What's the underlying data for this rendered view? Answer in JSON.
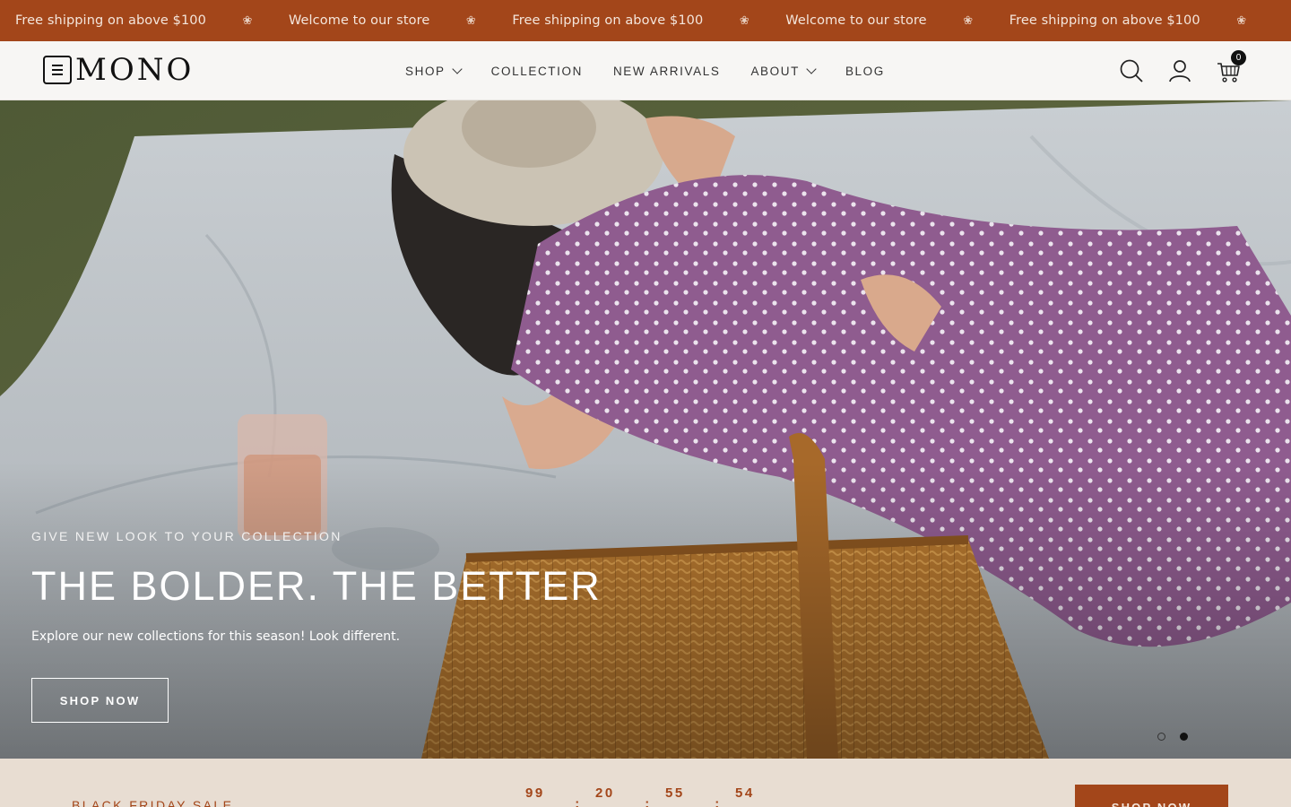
{
  "announcement": {
    "items": [
      "Free shipping on above $100",
      "Welcome to our store",
      "Free shipping on above $100",
      "Welcome to our store",
      "Free shipping on above $100"
    ],
    "separator": "❀"
  },
  "header": {
    "logo_text": "MONO",
    "nav": [
      {
        "label": "SHOP",
        "dropdown": true
      },
      {
        "label": "COLLECTION",
        "dropdown": false
      },
      {
        "label": "NEW ARRIVALS",
        "dropdown": false
      },
      {
        "label": "ABOUT",
        "dropdown": true
      },
      {
        "label": "BLOG",
        "dropdown": false
      }
    ],
    "icons": [
      "search-icon",
      "account-icon",
      "cart-icon"
    ],
    "cart_count": "0"
  },
  "hero": {
    "eyebrow": "GIVE NEW LOOK TO YOUR COLLECTION",
    "title": "THE BOLDER. THE BETTER",
    "subtitle": "Explore our new collections for this season! Look different.",
    "button_label": "SHOP NOW",
    "slides_total": 2,
    "active_slide": 2
  },
  "promo": {
    "label": "BLACK FRIDAY SALE",
    "countdown": [
      "99",
      "20",
      "55",
      "54"
    ],
    "separator": ":",
    "button_label": "SHOP NOW"
  },
  "colors": {
    "accent": "#a3461a",
    "promo_bg": "#e8ddd2",
    "header_bg": "#f7f6f4"
  }
}
